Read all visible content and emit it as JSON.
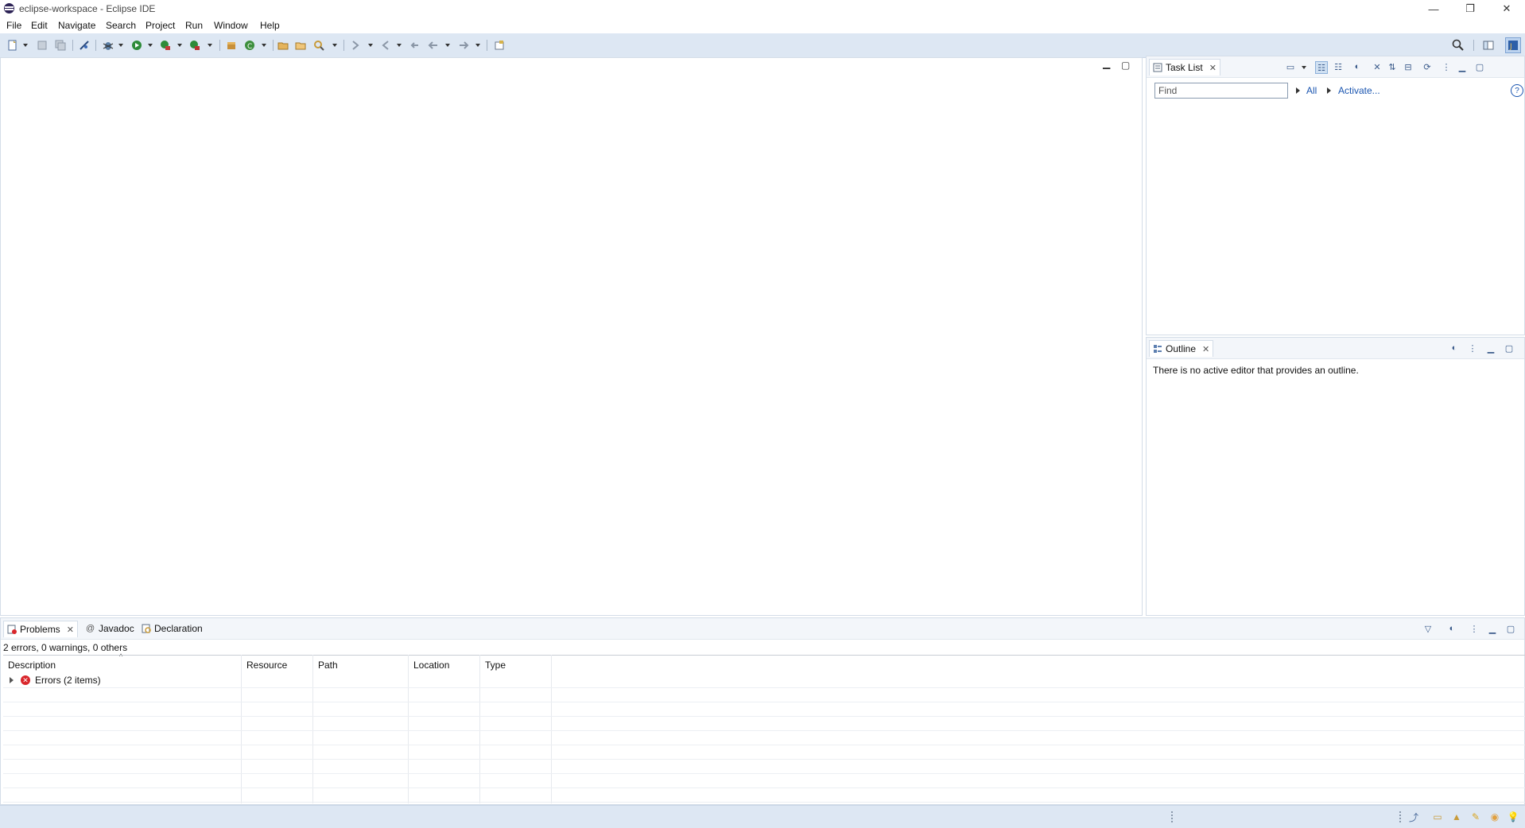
{
  "window": {
    "title": "eclipse-workspace - Eclipse IDE",
    "minimize_glyph": "—",
    "restore_glyph": "❐",
    "close_glyph": "✕"
  },
  "menu": {
    "items": [
      "File",
      "Edit",
      "Navigate",
      "Search",
      "Project",
      "Run",
      "Window",
      "Help"
    ]
  },
  "colors": {
    "toolbar_bg": "#dde7f3",
    "accent": "#1a55b0",
    "error": "#d9262b"
  },
  "task_list": {
    "tab_label": "Task List",
    "find_placeholder": "Find",
    "all_link": "All",
    "activate_link": "Activate..."
  },
  "outline": {
    "tab_label": "Outline",
    "empty_message": "There is no active editor that provides an outline."
  },
  "bottom": {
    "tabs": [
      {
        "label": "Problems",
        "icon": "problems-icon"
      },
      {
        "label": "Javadoc",
        "icon": "at-icon"
      },
      {
        "label": "Declaration",
        "icon": "declaration-icon"
      }
    ],
    "summary": "2 errors, 0 warnings, 0 others",
    "columns": [
      "Description",
      "Resource",
      "Path",
      "Location",
      "Type"
    ],
    "rows": [
      {
        "description": "Errors (2 items)"
      }
    ]
  },
  "icons": {
    "search": "search-icon",
    "perspective": "open-perspective-icon",
    "java_perspective": "java-perspective-icon"
  }
}
